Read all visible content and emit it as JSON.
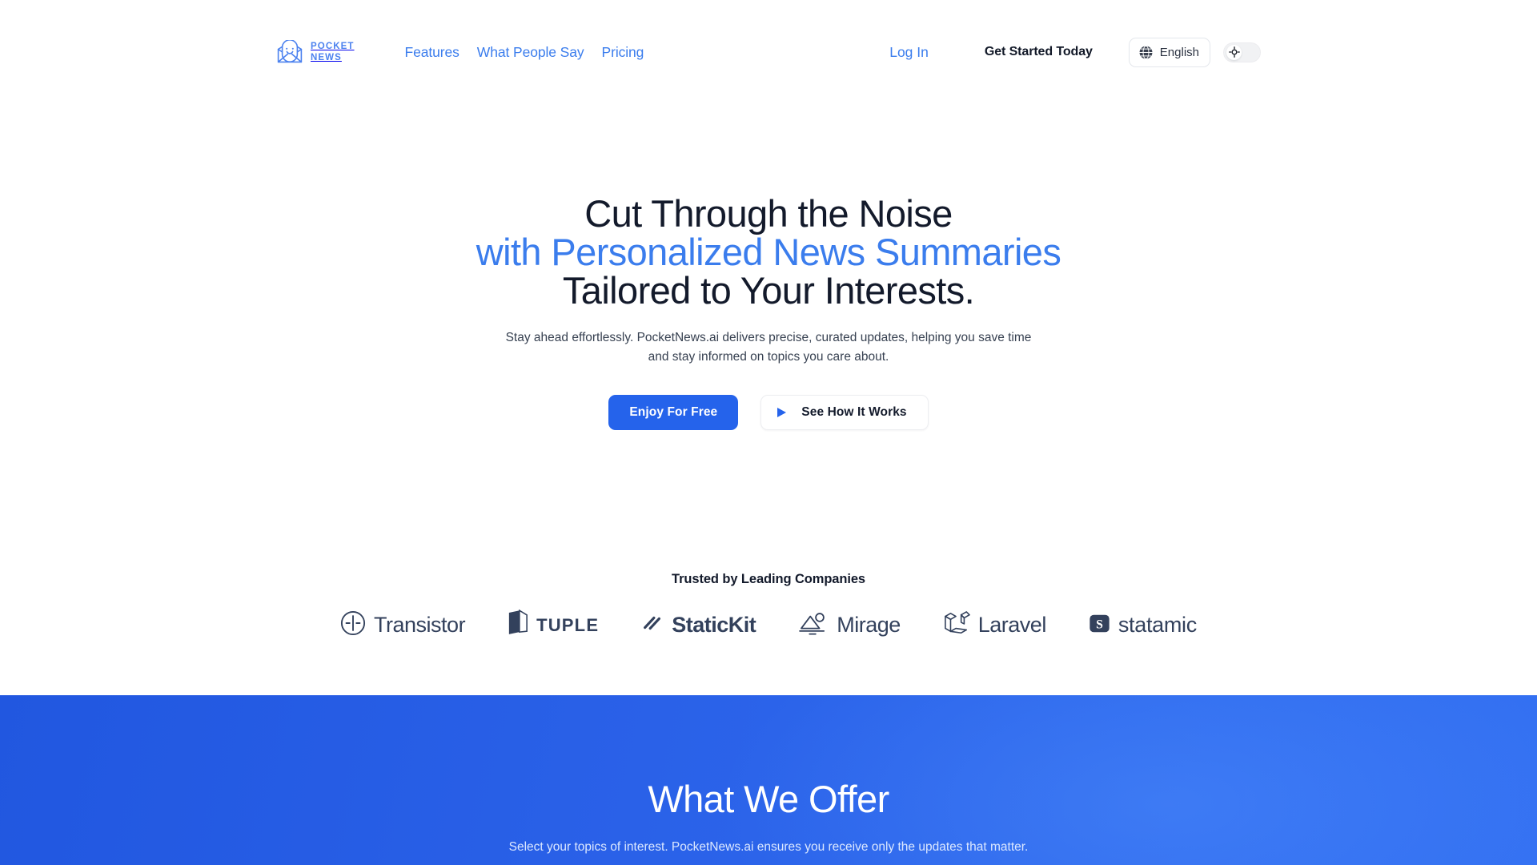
{
  "header": {
    "brand": {
      "line1": "POCKET",
      "line2": "NEWS",
      "icon": "envelope-smile-icon"
    },
    "nav": [
      {
        "label": "Features"
      },
      {
        "label": "What People Say"
      },
      {
        "label": "Pricing"
      }
    ],
    "login_label": "Log In",
    "get_started_label": "Get Started Today",
    "language": {
      "label": "English",
      "icon": "globe-icon"
    },
    "theme_toggle": {
      "state": "light",
      "icon": "sun-icon"
    }
  },
  "hero": {
    "headline_line1": "Cut Through the Noise",
    "headline_line2": "with Personalized News Summaries",
    "headline_line3": "Tailored to Your Interests.",
    "subtitle": "Stay ahead effortlessly. PocketNews.ai delivers precise, curated updates, helping you save time and stay informed on topics you care about.",
    "primary_cta": "Enjoy For Free",
    "secondary_cta": "See How It Works",
    "secondary_cta_icon": "play-icon"
  },
  "trusted": {
    "title": "Trusted by Leading Companies",
    "logos": [
      {
        "name": "Transistor",
        "icon": "transistor-icon"
      },
      {
        "name": "TUPLE",
        "icon": "tuple-icon"
      },
      {
        "name": "StaticKit",
        "icon": "statickit-icon"
      },
      {
        "name": "Mirage",
        "icon": "mirage-icon"
      },
      {
        "name": "Laravel",
        "icon": "laravel-icon"
      },
      {
        "name": "statamic",
        "icon": "statamic-icon"
      }
    ]
  },
  "offer": {
    "title": "What We Offer",
    "subtitle": "Select your topics of interest. PocketNews.ai ensures you receive only the updates that matter."
  },
  "colors": {
    "brand_blue": "#3b7ded",
    "primary_button": "#2563eb",
    "section_blue": "#2a61e8",
    "heading_dark": "#131a2b",
    "logo_gray": "#33415c"
  }
}
